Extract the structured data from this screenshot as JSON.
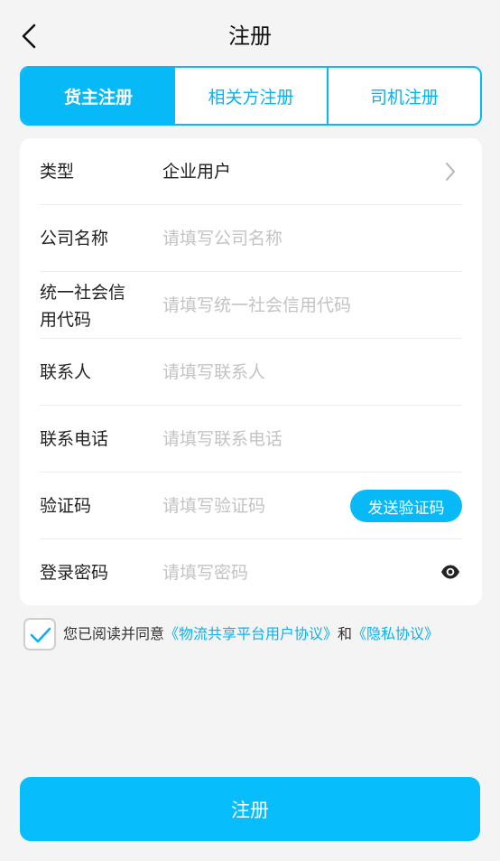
{
  "header": {
    "title": "注册"
  },
  "tabs": [
    {
      "label": "货主注册",
      "active": true
    },
    {
      "label": "相关方注册",
      "active": false
    },
    {
      "label": "司机注册",
      "active": false
    }
  ],
  "form": {
    "type": {
      "label": "类型",
      "value": "企业用户"
    },
    "company": {
      "label": "公司名称",
      "placeholder": "请填写公司名称"
    },
    "credit_code": {
      "label": "统一社会信用代码",
      "placeholder": "请填写统一社会信用代码"
    },
    "contact": {
      "label": "联系人",
      "placeholder": "请填写联系人"
    },
    "phone": {
      "label": "联系电话",
      "placeholder": "请填写联系电话"
    },
    "code": {
      "label": "验证码",
      "placeholder": "请填写验证码",
      "send_label": "发送验证码"
    },
    "password": {
      "label": "登录密码",
      "placeholder": "请填写密码"
    }
  },
  "agreement": {
    "checked": true,
    "prefix": "您已阅读并同意",
    "user_agreement": "《物流共享平台用户协议》",
    "conj": "和",
    "privacy": "《隐私协议》"
  },
  "submit": {
    "label": "注册"
  },
  "colors": {
    "accent": "#08b9f8",
    "background": "#f4f4f4",
    "placeholder": "#c3c3c3"
  }
}
